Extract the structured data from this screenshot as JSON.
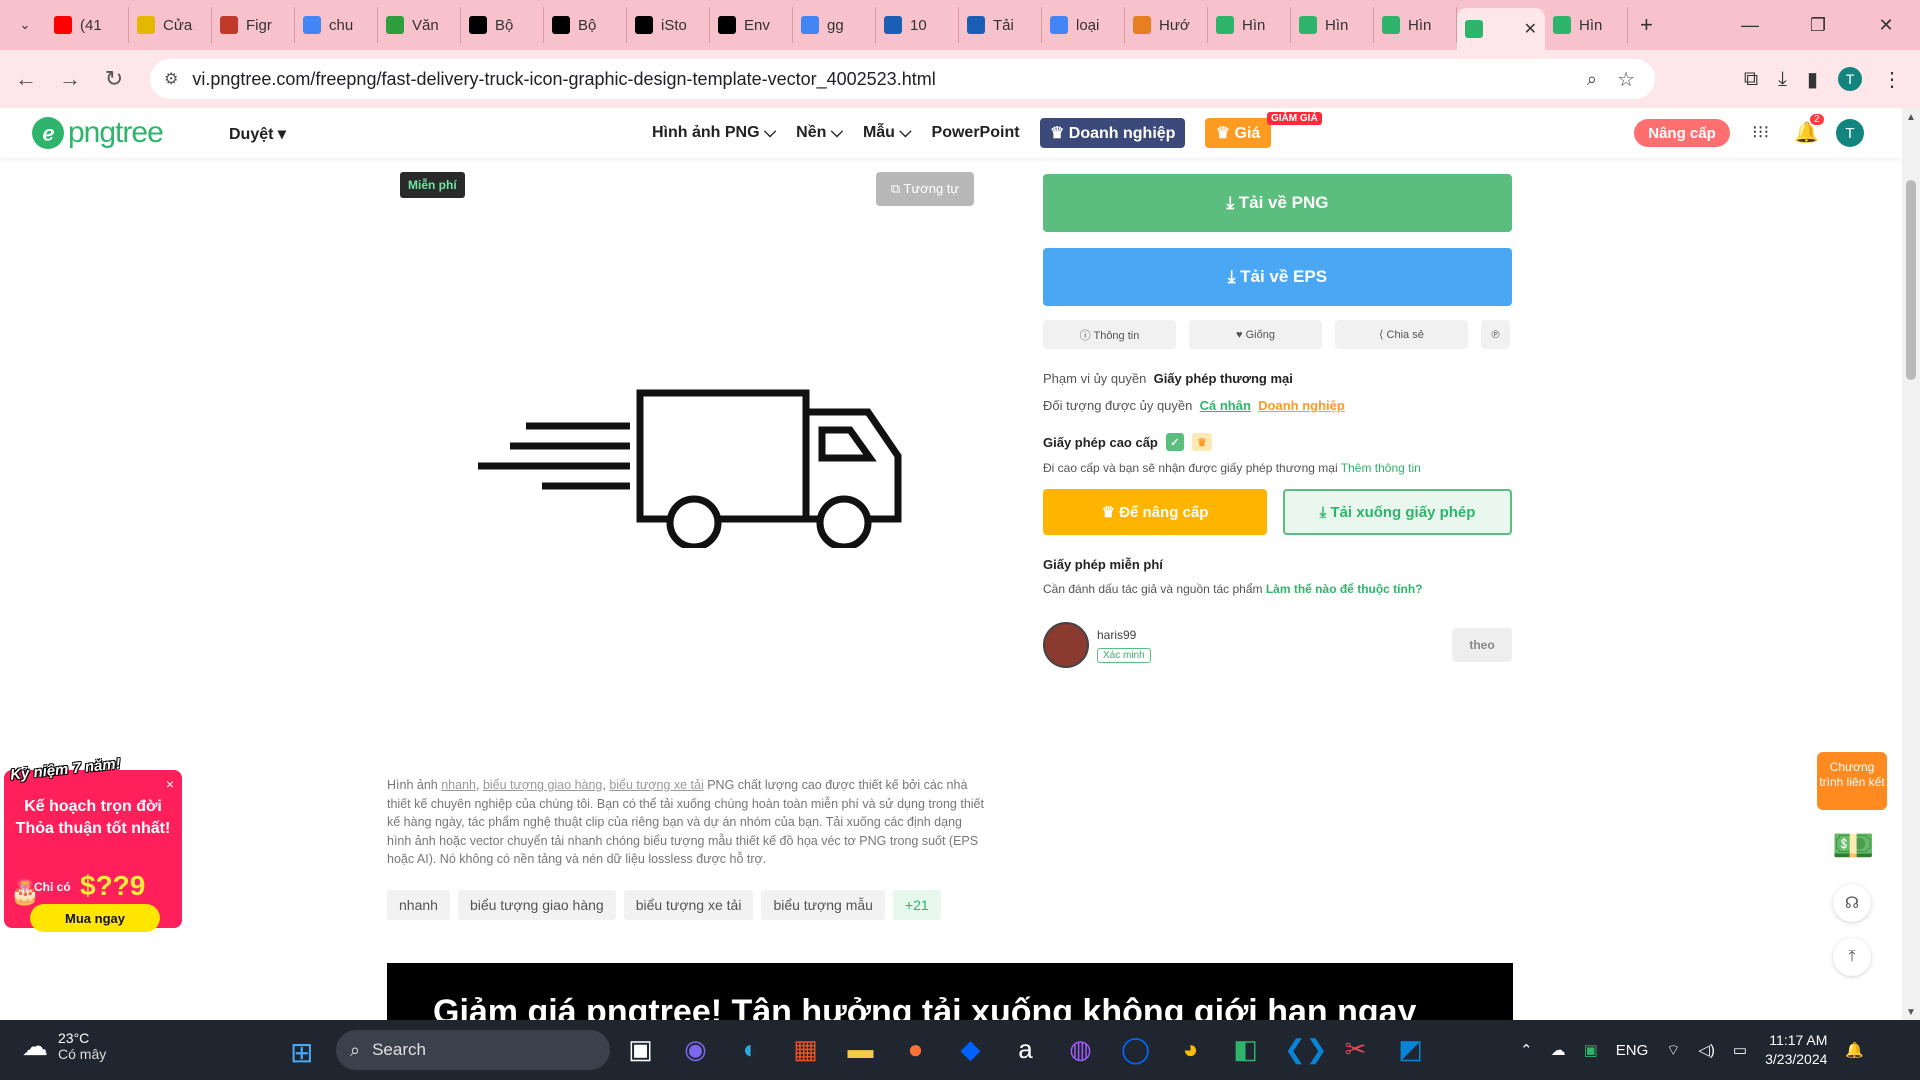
{
  "browser": {
    "tabs": [
      {
        "label": "(41",
        "icon": "youtube-icon",
        "color": "#ff0000"
      },
      {
        "label": "Cửa",
        "icon": "site-icon",
        "color": "#e5b800"
      },
      {
        "label": "Figr",
        "icon": "site-icon",
        "color": "#c0392b"
      },
      {
        "label": "chu",
        "icon": "google-icon",
        "color": "#4285f4"
      },
      {
        "label": "Văn",
        "icon": "px-icon",
        "color": "#2e9e3e"
      },
      {
        "label": "Bộ",
        "icon": "istock-icon",
        "color": "#000000"
      },
      {
        "label": "Bộ",
        "icon": "istock-icon",
        "color": "#000000"
      },
      {
        "label": "iSto",
        "icon": "istock-icon",
        "color": "#000000"
      },
      {
        "label": "Env",
        "icon": "istock-icon",
        "color": "#000000"
      },
      {
        "label": "gg",
        "icon": "google-icon",
        "color": "#4285f4"
      },
      {
        "label": "10",
        "icon": "site-icon",
        "color": "#1a5fb4"
      },
      {
        "label": "Tải",
        "icon": "site-icon",
        "color": "#1a5fb4"
      },
      {
        "label": "loại",
        "icon": "google-icon",
        "color": "#4285f4"
      },
      {
        "label": "Hướ",
        "icon": "site-icon",
        "color": "#e67e22"
      },
      {
        "label": "Hìn",
        "icon": "pngtree-icon",
        "color": "#2fb56b"
      },
      {
        "label": "Hìn",
        "icon": "pngtree-icon",
        "color": "#2fb56b"
      },
      {
        "label": "Hìn",
        "icon": "pngtree-icon",
        "color": "#2fb56b"
      },
      {
        "label": "",
        "icon": "pngtree-icon",
        "color": "#2fb56b",
        "active": true
      },
      {
        "label": "Hìn",
        "icon": "pngtree-icon",
        "color": "#2fb56b"
      }
    ],
    "url": "vi.pngtree.com/freepng/fast-delivery-truck-icon-graphic-design-template-vector_4002523.html",
    "profile_initial": "T"
  },
  "site": {
    "logo_text": "pngtree",
    "browse": "Duyệt ▾",
    "menu": [
      "Hình ảnh PNG ⌵",
      "Nền ⌵",
      "Mẫu ⌵",
      "PowerPoint"
    ],
    "enterprise": "♛ Doanh nghiệp",
    "price": "♛ Giá",
    "sale_badge": "GIẢM GIÁ",
    "upgrade": "Nâng cấp",
    "bell_count": "2",
    "avatar_initial": "T"
  },
  "preview": {
    "free_badge": "Miễn phí",
    "similar_button": "⧉ Tương tự"
  },
  "description": {
    "prefix": "Hình ảnh",
    "link1": "nhanh",
    "link2": "biểu tượng giao hàng",
    "link3": "biểu tượng xe tải",
    "body": " PNG chất lượng cao được thiết kế bởi các nhà thiết kế chuyên nghiệp của chúng tôi. Bạn có thể tải xuống chúng hoàn toàn miễn phí và sử dụng trong thiết kế hàng ngày, tác phẩm nghệ thuật clip của riêng bạn và dự án nhóm của bạn. Tải xuống các định dạng hình ảnh hoặc vector chuyển tải nhanh chóng biểu tượng mẫu thiết kế đồ họa véc tơ PNG trong suốt (EPS hoặc AI). Nó không có nền tảng và nén dữ liệu lossless được hỗ trợ."
  },
  "tags": [
    "nhanh",
    "biểu tượng giao hàng",
    "biểu tượng xe tải",
    "biểu tượng mẫu",
    "+21"
  ],
  "promo_bar": "Giảm giá pngtree! Tận hưởng tải xuống không giới hạn ngay",
  "sidebar": {
    "download_png": "⤓ Tải về PNG",
    "download_eps": "⤓ Tải về EPS",
    "info": "ⓘ Thông tin",
    "like": "♥ Giống",
    "share": "⟨ Chia sẻ",
    "pinterest": "℗",
    "scope_label": "Phạm vi ủy quyền",
    "scope_value": "Giấy phép thương mại",
    "target_label": "Đối tượng được ủy quyền",
    "target_personal": "Cá nhân",
    "target_business": "Doanh nghiệp",
    "premium_title": "Giấy phép cao cấp",
    "premium_text": "Đi cao cấp và bạn sẽ nhận được giấy phép thương mại",
    "premium_more": "Thêm thông tin",
    "btn_upgrade": "♛ Để nâng cấp",
    "btn_license": "⤓ Tải xuống giấy phép",
    "free_title": "Giấy phép miễn phí",
    "free_text": "Cần đánh dấu tác giả và nguồn tác phẩm",
    "free_link": "Làm thế nào để thuộc tính?",
    "author_name": "haris99",
    "verified": "Xác minh",
    "follow": "theo"
  },
  "popup": {
    "top": "Kỷ niệm 7 năm!",
    "close": "×",
    "line1": "Kế hoạch trọn đời Thỏa thuận tốt nhất!",
    "only": "Chỉ có",
    "price": "$??9",
    "buy": "Mua ngay"
  },
  "floating": {
    "affiliate": "Chương trình liên kết"
  },
  "taskbar": {
    "temp": "23°C",
    "weather": "Có mây",
    "search": "Search",
    "lang": "ENG",
    "time": "11:17 AM",
    "date": "3/23/2024"
  }
}
